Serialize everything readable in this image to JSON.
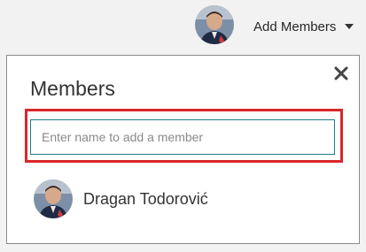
{
  "header": {
    "add_members_label": "Add Members"
  },
  "panel": {
    "title": "Members",
    "search": {
      "placeholder": "Enter name to add a member",
      "value": ""
    },
    "members": [
      {
        "name": "Dragan Todorović"
      }
    ]
  },
  "colors": {
    "highlight_border": "#d9262a",
    "input_border": "#1f7a8c"
  },
  "icons": {
    "close": "close-icon",
    "caret": "chevron-down-icon",
    "avatar": "avatar"
  }
}
